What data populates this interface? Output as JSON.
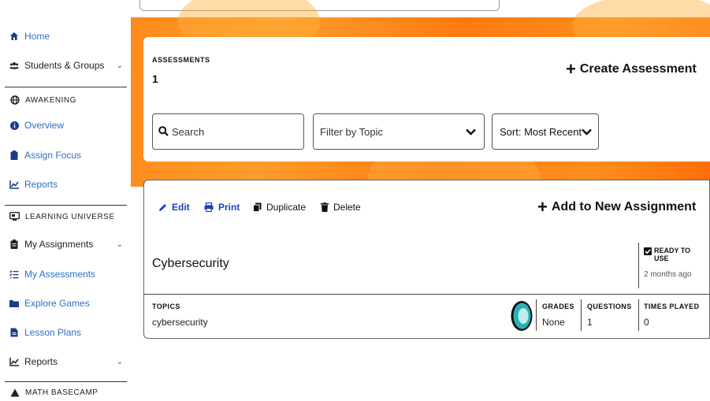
{
  "sidebar": {
    "home": "Home",
    "students_groups": "Students & Groups",
    "awakening_section": "AWAKENING",
    "overview": "Overview",
    "assign_focus": "Assign Focus",
    "reports_1": "Reports",
    "learning_universe_section": "LEARNING UNIVERSE",
    "my_assignments": "My Assignments",
    "my_assessments": "My Assessments",
    "explore_games": "Explore Games",
    "lesson_plans": "Lesson Plans",
    "reports_2": "Reports",
    "math_basecamp_section": "MATH BASECAMP"
  },
  "assessments": {
    "label": "ASSESSMENTS",
    "count": "1",
    "create_label": "Create Assessment"
  },
  "filters": {
    "search_placeholder": "Search",
    "topic_label": "Filter by Topic",
    "sort_label": "Sort: Most Recent"
  },
  "item": {
    "edit": "Edit",
    "print": "Print",
    "duplicate": "Duplicate",
    "delete": "Delete",
    "add_assignment": "Add to New Assignment",
    "title": "Cybersecurity",
    "status_line1": "READY TO",
    "status_line2": "USE",
    "status_time": "2 months ago",
    "topics_header": "TOPICS",
    "topics_value": "cybersecurity",
    "grades_header": "GRADES",
    "grades_value": "None",
    "questions_header": "QUESTIONS",
    "questions_value": "1",
    "times_played_header": "TIMES PLAYED",
    "times_played_value": "0"
  },
  "colors": {
    "link_blue": "#2c6fc7",
    "action_blue": "#1f3fbf",
    "orange": "#ff8a1c",
    "badge_teal": "#2ab0b4"
  },
  "icons": {
    "home": "home-icon",
    "students": "users-icon",
    "awakening": "globe-icon",
    "overview": "info-icon",
    "assign_focus": "clipboard-icon",
    "reports": "line-chart-icon",
    "learning_universe": "monitor-icon",
    "my_assignments": "clipboard-list-icon",
    "my_assessments": "list-check-icon",
    "explore_games": "folder-icon",
    "lesson_plans": "file-icon",
    "math_basecamp": "mountain-icon"
  }
}
